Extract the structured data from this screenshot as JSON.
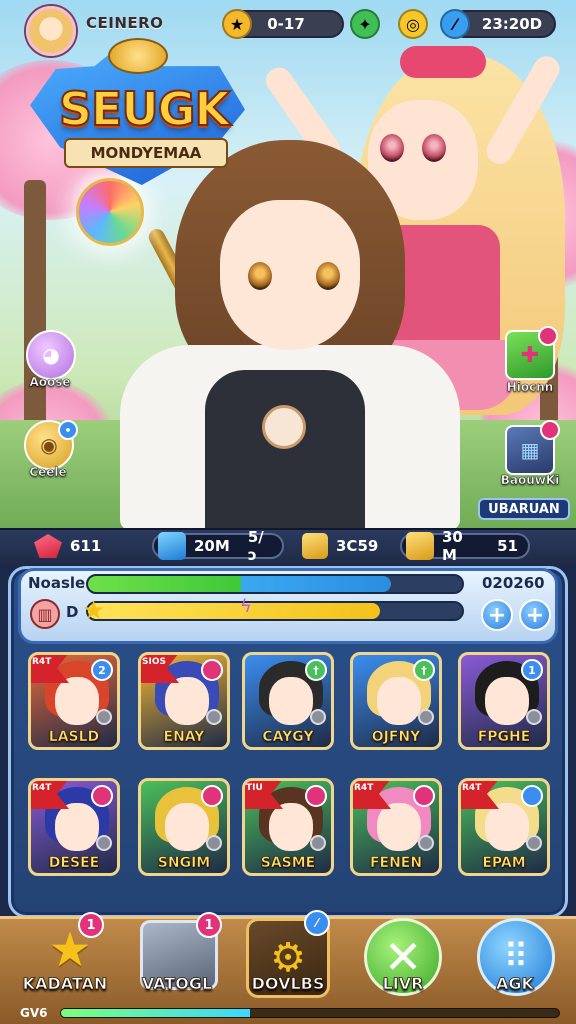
{
  "player": {
    "name": "CEINERO"
  },
  "hud": {
    "currency1": "0-17",
    "currency2": "23:20D"
  },
  "logo": {
    "title": "SEUGK",
    "subtitle": "MONDYEMAA"
  },
  "side_buttons": {
    "left": [
      {
        "label": "Aoose"
      },
      {
        "label": "Ceele"
      }
    ],
    "right": [
      {
        "label": "Hiocnn"
      },
      {
        "label": "BaouwKi"
      }
    ]
  },
  "event_banner": "UBARUAN",
  "resources": {
    "gems": "611",
    "stamina": "20M",
    "stamina_suffix": "5/ↄ",
    "gold": "3C59",
    "coins": "30 M",
    "coins_suffix": "51"
  },
  "status": {
    "label1": "Noasle",
    "value1": "020260",
    "label2": "D",
    "bar1_fill": 0.81,
    "bar2_fill": 0.78
  },
  "roster": [
    {
      "name": "LASLD",
      "badge": "2",
      "color": "#e86a3a",
      "hair": "#d9452b",
      "elem": "#3b8ef0",
      "ribbon": "R4T"
    },
    {
      "name": "ENAY",
      "badge": "",
      "color": "#f2b733",
      "hair": "#3a4bb8",
      "elem": "#e0337a",
      "ribbon": "SIOS"
    },
    {
      "name": "CAYGY",
      "badge": "†",
      "color": "#3b8ef0",
      "hair": "#2b2b2b",
      "elem": "#4bbf5a",
      "ribbon": ""
    },
    {
      "name": "OJFNY",
      "badge": "†",
      "color": "#3b8ef0",
      "hair": "#f3d27a",
      "elem": "#4bbf5a",
      "ribbon": ""
    },
    {
      "name": "FPGHE",
      "badge": "1",
      "color": "#8a5bd6",
      "hair": "#1d1d1d",
      "elem": "#3b8ef0",
      "ribbon": ""
    },
    {
      "name": "DESEE",
      "badge": "",
      "color": "#8a5bd6",
      "hair": "#2c3aa8",
      "elem": "#e0337a",
      "ribbon": "R4T"
    },
    {
      "name": "SNGIM",
      "badge": "",
      "color": "#4bbf5a",
      "hair": "#e8c23a",
      "elem": "#e0337a",
      "ribbon": ""
    },
    {
      "name": "SASME",
      "badge": "",
      "color": "#4bbf5a",
      "hair": "#5a3422",
      "elem": "#e0337a",
      "ribbon": "TIU"
    },
    {
      "name": "FENEN",
      "badge": "",
      "color": "#4bbf5a",
      "hair": "#f08ac0",
      "elem": "#e0337a",
      "ribbon": "R4T"
    },
    {
      "name": "EPAM",
      "badge": "",
      "color": "#4bbf5a",
      "hair": "#f3dc8a",
      "elem": "#3b8ef0",
      "ribbon": "R4T"
    }
  ],
  "nav": [
    {
      "label": "KADATAN",
      "badge": "1"
    },
    {
      "label": "VATOGL",
      "badge": "1"
    },
    {
      "label": "DOVLBS",
      "badge": ""
    },
    {
      "label": "LIVR",
      "badge": ""
    },
    {
      "label": "AGK",
      "badge": ""
    }
  ],
  "level": {
    "label": "GV6",
    "xp": 0.38
  },
  "colors": {
    "accent": "#3b8ef0",
    "gold": "#ffcf3d",
    "panel": "#2a4f8a"
  }
}
